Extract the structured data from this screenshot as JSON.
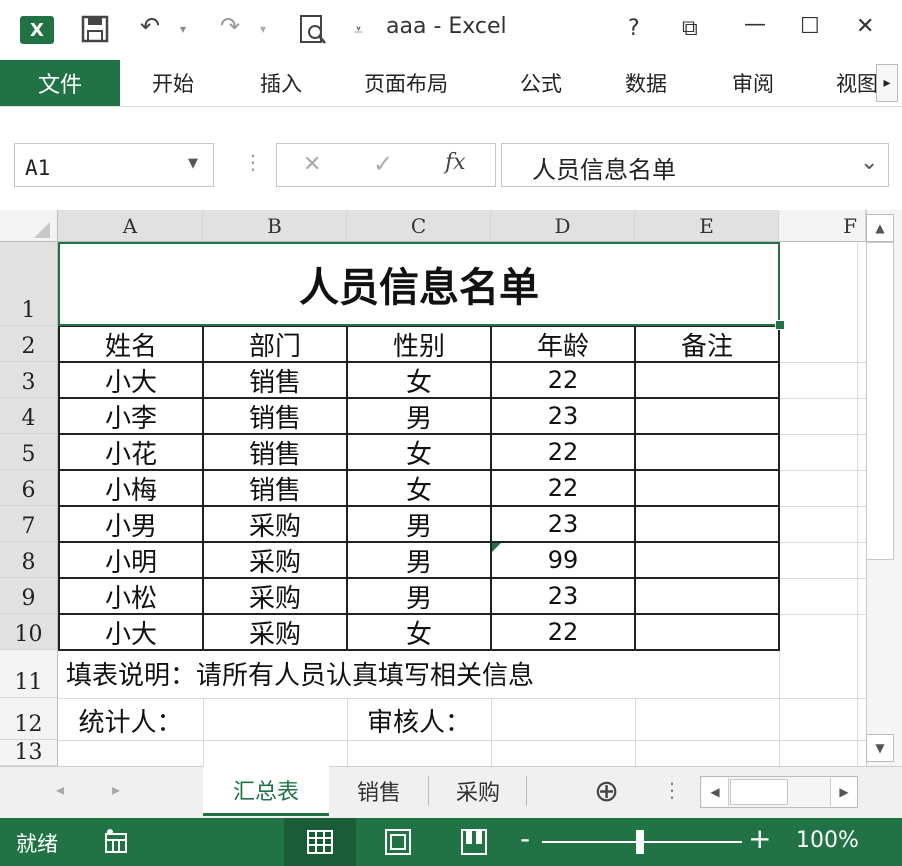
{
  "window": {
    "title": "aaa - Excel",
    "help": "?",
    "ribbon_display": "⧉",
    "maximize": "☐",
    "close": "✕"
  },
  "qat": {
    "excel_logo": "X",
    "save": "💾",
    "undo": "↶",
    "redo": "↷",
    "preview": "🔍",
    "customize": "⩡"
  },
  "ribbon": {
    "file": "文件",
    "tabs": [
      "开始",
      "插入",
      "页面布局",
      "公式",
      "数据",
      "审阅",
      "视图"
    ],
    "more": "▸"
  },
  "formula_bar": {
    "name_box": "A1",
    "name_box_arrow": "▼",
    "cancel": "✕",
    "enter": "✓",
    "fx": "fx",
    "content": "人员信息名单",
    "expand": "⌄"
  },
  "columns": [
    "A",
    "B",
    "C",
    "D",
    "E",
    "F"
  ],
  "rows": [
    "1",
    "2",
    "3",
    "4",
    "5",
    "6",
    "7",
    "8",
    "9",
    "10",
    "11",
    "12",
    "13"
  ],
  "sheet": {
    "title": "人员信息名单",
    "headers": [
      "姓名",
      "部门",
      "性别",
      "年龄",
      "备注"
    ],
    "data": [
      [
        "小大",
        "销售",
        "女",
        "22",
        ""
      ],
      [
        "小李",
        "销售",
        "男",
        "23",
        ""
      ],
      [
        "小花",
        "销售",
        "女",
        "22",
        ""
      ],
      [
        "小梅",
        "销售",
        "女",
        "22",
        ""
      ],
      [
        "小男",
        "采购",
        "男",
        "23",
        ""
      ],
      [
        "小明",
        "采购",
        "男",
        "99",
        ""
      ],
      [
        "小松",
        "采购",
        "男",
        "23",
        ""
      ],
      [
        "小大",
        "采购",
        "女",
        "22",
        ""
      ]
    ],
    "note": "填表说明：请所有人员认真填写相关信息",
    "stat_label": "统计人：",
    "review_label": "审核人："
  },
  "sheet_tabs": {
    "items": [
      "汇总表",
      "销售",
      "采购"
    ],
    "active": 0,
    "add": "⊕",
    "prev": "◂",
    "next": "▸"
  },
  "status": {
    "ready": "就绪",
    "zoom_minus": "-",
    "zoom_plus": "+",
    "zoom": "100%",
    "zoom_level": 0.5
  },
  "scroll": {
    "up": "▲",
    "down": "▼",
    "left": "◀",
    "right": "▶"
  }
}
